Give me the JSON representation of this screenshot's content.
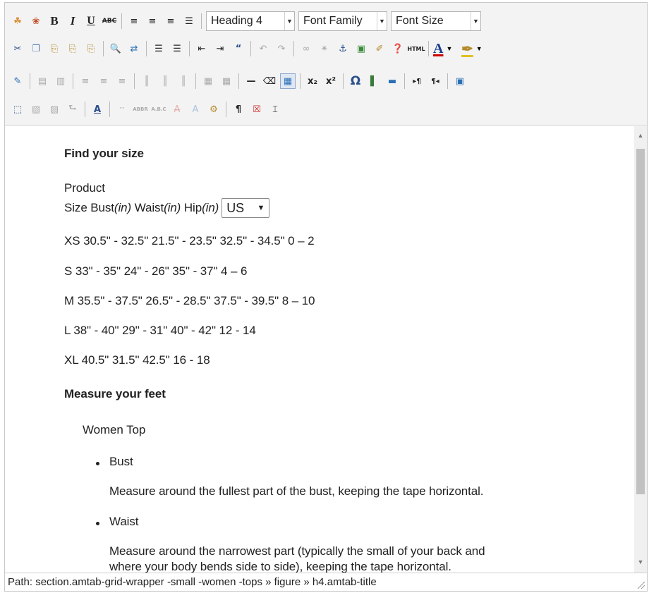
{
  "toolbar": {
    "block_format": "Heading 4",
    "font_family": "Font Family",
    "font_size": "Font Size"
  },
  "content": {
    "heading_find_size": "Find your size",
    "product_label": "Product",
    "size_header": {
      "size": "Size",
      "bust": "Bust",
      "bust_unit": "(in)",
      "waist": "Waist",
      "waist_unit": "(in)",
      "hip": "Hip",
      "hip_unit": "(in)"
    },
    "region_select_value": "US",
    "size_rows": [
      "XS 30.5\" - 32.5\" 21.5\" - 23.5\" 32.5\" - 34.5\" 0 – 2",
      "S 33\" - 35\" 24\" - 26\" 35\" - 37\" 4 – 6",
      "M 35.5\" - 37.5\" 26.5\" - 28.5\" 37.5\" - 39.5\" 8 – 10",
      "L 38\" - 40\" 29\" - 31\" 40\" - 42\" 12 - 14",
      "XL 40.5\" 31.5\" 42.5\" 16 - 18"
    ],
    "heading_measure": "Measure your feet",
    "women_top": "Women Top",
    "measures": [
      {
        "term": "Bust",
        "desc": "Measure around the fullest part of the bust, keeping the tape horizontal."
      },
      {
        "term": "Waist",
        "desc_line1": "Measure around the narrowest part (typically the small of your back and",
        "desc_line2": "where your body bends side to side), keeping the tape horizontal."
      }
    ]
  },
  "status": {
    "path": "Path: section.amtab-grid-wrapper -small -women -tops » figure » h4.amtab-title"
  },
  "colors": {
    "toolbar_bg": "#f3f3f3",
    "text": "#222222",
    "scroll_thumb": "#c1c1c1"
  }
}
